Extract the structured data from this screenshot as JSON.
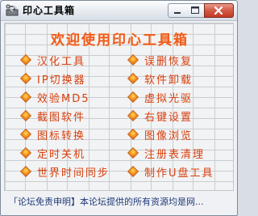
{
  "window": {
    "title": "印心工具箱"
  },
  "banner": {
    "text": "欢迎使用印心工具箱"
  },
  "left_items": [
    {
      "label": "汉化工具"
    },
    {
      "label": "IP切换器"
    },
    {
      "label": "效验MD5"
    },
    {
      "label": "截图软件"
    },
    {
      "label": "图标转换"
    },
    {
      "label": "定时关机"
    },
    {
      "label": "世界时间同步"
    }
  ],
  "right_items": [
    {
      "label": "误删恢复"
    },
    {
      "label": "软件卸载"
    },
    {
      "label": "虚拟光驱"
    },
    {
      "label": "右键设置"
    },
    {
      "label": "图像浏览"
    },
    {
      "label": "注册表清理"
    },
    {
      "label": "制作U盘工具"
    }
  ],
  "footer": {
    "text": "「论坛免责申明】本论坛提供的所有资源均是网..."
  },
  "colors": {
    "item_text": "#d8410f",
    "banner": "#f05a1a",
    "footer": "#1e3a78"
  },
  "icons": {
    "app": "toolbox-icon",
    "bullet": "diamond-bullet-icon"
  }
}
